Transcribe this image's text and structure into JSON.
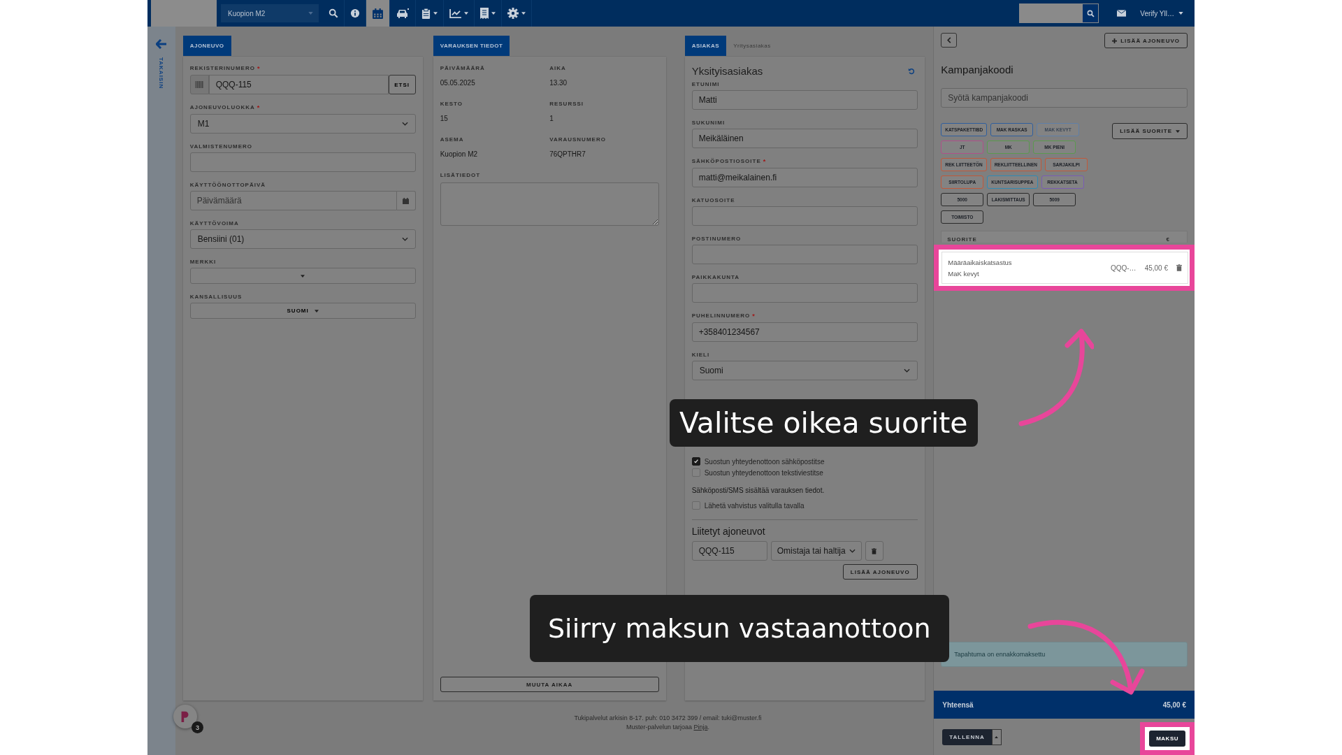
{
  "topbar": {
    "location": "Kuopion M2",
    "user": "Verify Yll…",
    "tools": [
      {
        "kind": "search",
        "selected": false,
        "menu": false
      },
      {
        "kind": "info",
        "selected": false,
        "menu": false
      },
      {
        "kind": "calendar",
        "selected": true,
        "menu": false
      },
      {
        "kind": "car",
        "selected": false,
        "menu": false
      },
      {
        "kind": "clipboard",
        "selected": false,
        "menu": true
      },
      {
        "kind": "chart",
        "selected": false,
        "menu": true
      },
      {
        "kind": "receipt",
        "selected": false,
        "menu": true
      },
      {
        "kind": "gear",
        "selected": false,
        "menu": true
      }
    ]
  },
  "sidebar": {
    "back_label": "TAKAISIN"
  },
  "vehicle": {
    "tab": "AJONEUVO",
    "fields": [
      {
        "kind": "search",
        "label": "REKISTERINUMERO",
        "required_mark": "*",
        "value": "QQQ-115",
        "button": "ETSI"
      },
      {
        "kind": "select",
        "label": "AJONEUVOLUOKKA",
        "required_mark": "*",
        "value": "M1"
      },
      {
        "kind": "input",
        "label": "VALMISTENUMERO"
      },
      {
        "kind": "date",
        "label": "KÄYTTÖÖNOTTOPÄIVÄ",
        "placeholder": "Päivämäärä"
      },
      {
        "kind": "select",
        "label": "KÄYTTÖVOIMA",
        "value": "Bensiini (01)"
      },
      {
        "kind": "dropdown",
        "label": "MERKKI"
      },
      {
        "kind": "dropdown",
        "label": "KANSALLISUUS",
        "value": "SUOMI"
      }
    ]
  },
  "booking": {
    "tab": "VARAUKSEN TIEDOT",
    "details": [
      {
        "label": "PÄIVÄMÄÄRÄ",
        "value": "05.05.2025"
      },
      {
        "label": "AIKA",
        "value": "13.30"
      },
      {
        "label": "KESTO",
        "value": "15"
      },
      {
        "label": "RESURSSI",
        "value": "1"
      },
      {
        "label": "ASEMA",
        "value": "Kuopion M2"
      },
      {
        "label": "VARAUSNUMERO",
        "value": "76QPTHR7"
      }
    ],
    "notes_label": "LISÄTIEDOT",
    "change_time_button": "MUUTA AIKAA"
  },
  "customer": {
    "tabs": [
      {
        "label": "ASIAKAS",
        "selected": true
      },
      {
        "label": "Yritysasiakas",
        "selected": false
      }
    ],
    "heading": "Yksityisasiakas",
    "fields": [
      {
        "kind": "input",
        "label": "ETUNIMI",
        "value": "Matti"
      },
      {
        "kind": "input",
        "label": "SUKUNIMI",
        "value": "Meikäläinen"
      },
      {
        "kind": "input",
        "label": "SÄHKÖPOSTIOSOITE",
        "required_mark": "*",
        "value": "matti@meikalainen.fi"
      },
      {
        "kind": "input",
        "label": "KATUOSOITE"
      },
      {
        "kind": "input",
        "label": "POSTINUMERO"
      },
      {
        "kind": "input",
        "label": "PAIKKAKUNTA"
      },
      {
        "kind": "input",
        "label": "PUHELINNUMERO",
        "required_mark": "*",
        "value": "+358401234567"
      },
      {
        "kind": "select",
        "label": "KIELI",
        "value": "Suomi"
      }
    ],
    "consents": [
      {
        "label": "Suostun yhteydenottoon sähköpostitse",
        "checked": true
      },
      {
        "label": "Suostun yhteydenottoon tekstiviestitse",
        "checked": false
      }
    ],
    "info_text": "Sähköposti/SMS sisältää varauksen tiedot.",
    "confirmation": {
      "label": "Lähetä vahvistus valitulla tavalla",
      "checked": false
    },
    "linked_heading": "Liitetyt ajoneuvot",
    "linked_vehicles": [
      {
        "plate": "QQQ-115",
        "role": "Omistaja tai haltija"
      }
    ],
    "add_vehicle_button": "LISÄÄ AJONEUVO"
  },
  "cart": {
    "add_vehicle_button": "LISÄÄ AJONEUVO",
    "campaign_heading": "Kampanjakoodi",
    "campaign_placeholder": "Syötä kampanjakoodi",
    "add_service_button": "LISÄÄ SUORITE",
    "tags": [
      {
        "label": "KATSPAKETTIBD",
        "color": "#2f5f9e",
        "disabled": false
      },
      {
        "label": "MAK RASKAS",
        "color": "#2f5f9e",
        "disabled": false
      },
      {
        "label": "MAK KEVYT",
        "color": "#5f7fa8",
        "disabled": true
      },
      {
        "label": "JT",
        "color": "#b0508a",
        "disabled": false
      },
      {
        "label": "MK",
        "color": "#5a9a4e",
        "disabled": false
      },
      {
        "label": "MK PIENI",
        "color": "#5a9a4e",
        "disabled": false
      },
      {
        "label": "REK LIITTEETÖN",
        "color": "#c0583a",
        "disabled": false
      },
      {
        "label": "REKLIITTEELLINEN",
        "color": "#c0583a",
        "disabled": false
      },
      {
        "label": "SARJAKILPI",
        "color": "#c0583a",
        "disabled": false
      },
      {
        "label": "SIIRTOLUPA",
        "color": "#c0583a",
        "disabled": false
      },
      {
        "label": "KUNTSARISUPPEA",
        "color": "#2f8ab4",
        "disabled": false
      },
      {
        "label": "REKKATSETA",
        "color": "#7a5cb4",
        "disabled": false
      },
      {
        "label": "5000",
        "color": "#2a2a2a",
        "disabled": false
      },
      {
        "label": "LAKISMITTAUS",
        "color": "#2a2a2a",
        "disabled": false
      },
      {
        "label": "5009",
        "color": "#2a2a2a",
        "disabled": false
      },
      {
        "label": "TOIMISTO",
        "color": "#2a2a2a",
        "disabled": false
      }
    ],
    "table_columns": [
      "SUORITE",
      "€"
    ],
    "rows": [
      {
        "name": "Määräaikaiskatsastus",
        "subtitle": "MaK kevyt",
        "vehicle": "QQQ-…",
        "price": "45,00 €",
        "highlighted": true
      }
    ],
    "notice": "Tapahtuma on ennakkomaksettu",
    "total_label": "Yhteensä",
    "total": "45,00 €",
    "save_button": "TALLENNA",
    "pay_button": {
      "label": "MAKSU",
      "highlighted": true
    }
  },
  "chat_badge": "3",
  "footer": {
    "line_1": "Tukipalvelut arkisin 8-17. puh: 010 3472 399 / email: tuki@muster.fi",
    "line_2": "Muster-palvelun tarjoaa",
    "link": "Pinja",
    "line_2_end": "."
  },
  "callouts": [
    {
      "kind": "top",
      "text": "Valitse oikea suorite"
    },
    {
      "kind": "bottom",
      "text": "Siirry maksun vastaanottoon"
    }
  ]
}
